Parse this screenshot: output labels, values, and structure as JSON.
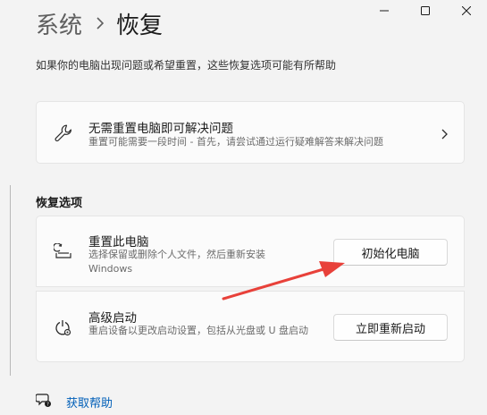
{
  "breadcrumb": {
    "parent": "系统",
    "separator": "chevron-right-icon",
    "current": "恢复"
  },
  "intro_text": "如果你的电脑出现问题或希望重置，这些恢复选项可能有所帮助",
  "fix_card": {
    "icon": "wrench-icon",
    "title": "无需重置电脑即可解决问题",
    "subtitle": "重置可能需要一段时间 - 首先，请尝试通过运行疑难解答来解决问题"
  },
  "recovery_section_title": "恢复选项",
  "reset_card": {
    "icon": "reset-pc-icon",
    "title": "重置此电脑",
    "subtitle": "选择保留或删除个人文件，然后重新安装 Windows",
    "button_label": "初始化电脑"
  },
  "advanced_card": {
    "icon": "advanced-startup-icon",
    "title": "高级启动",
    "subtitle": "重启设备以更改启动设置，包括从光盘或 U 盘启动",
    "button_label": "立即重新启动"
  },
  "help_link": {
    "icon": "help-chat-icon",
    "label": "获取帮助"
  },
  "window_controls": [
    "minimize-icon",
    "maximize-icon",
    "close-icon"
  ],
  "colors": {
    "background": "#f3f3f3",
    "card": "#fbfbfb",
    "link": "#005fb8",
    "annotation_arrow": "#e8413a"
  }
}
